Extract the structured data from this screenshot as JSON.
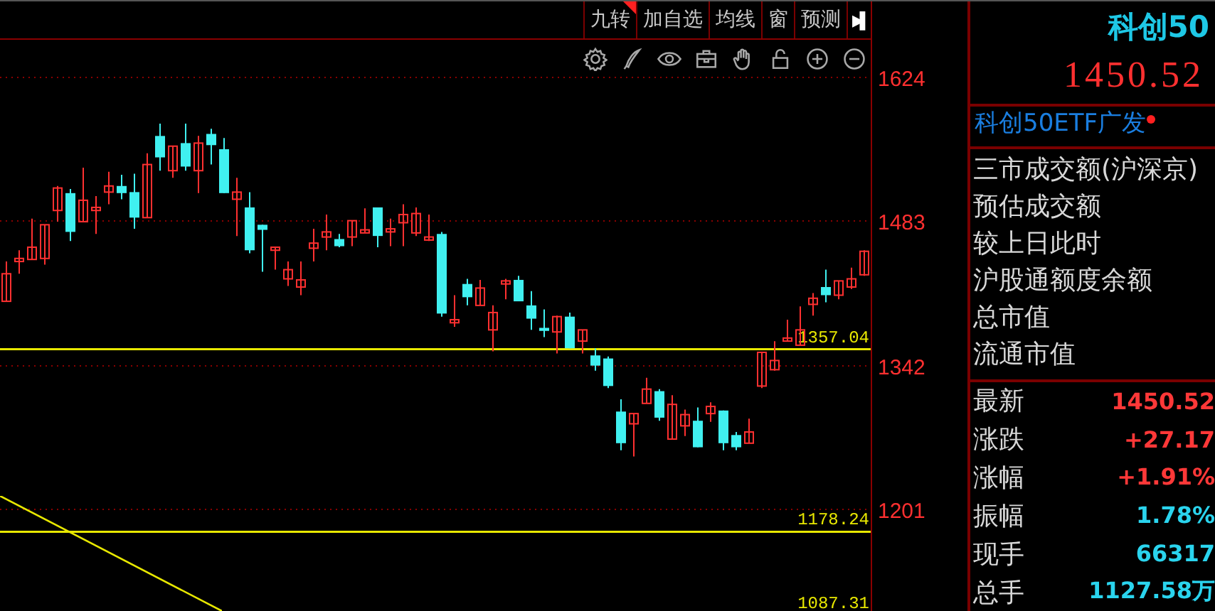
{
  "toolbar": {
    "buttons": [
      {
        "label": "九转",
        "flagged": true
      },
      {
        "label": "加自选",
        "flagged": false
      },
      {
        "label": "均线",
        "flagged": false
      },
      {
        "label": "窗",
        "flagged": false
      },
      {
        "label": "预测",
        "flagged": false
      }
    ],
    "end_button": "▶▌"
  },
  "chart": {
    "chart_data": {
      "type": "candlestick",
      "ylim": [
        1100.6,
        1697.8
      ],
      "yticks": [
        {
          "value": 1624,
          "label": "1624"
        },
        {
          "value": 1483,
          "label": "1483"
        },
        {
          "value": 1342,
          "label": "1342"
        },
        {
          "value": 1201,
          "label": "1201"
        }
      ],
      "categories": [
        null,
        null,
        null,
        null,
        null,
        null,
        null,
        null,
        null,
        null,
        null,
        null,
        null,
        null,
        null,
        null,
        null,
        null,
        null,
        null,
        null,
        null,
        null,
        null,
        null,
        null,
        null,
        null,
        null,
        null,
        null,
        null,
        null,
        null,
        null,
        null,
        null,
        null,
        null,
        null,
        null,
        null,
        null,
        null,
        null,
        null,
        null,
        null,
        null,
        null,
        null,
        null,
        null,
        null,
        null,
        null,
        null,
        null,
        null,
        null,
        null,
        null,
        null,
        null,
        null,
        null,
        null,
        null
      ],
      "ohlc": [
        [
          1404,
          1443,
          1404,
          1431
        ],
        [
          1443,
          1454,
          1431,
          1446
        ],
        [
          1445,
          1485,
          1445,
          1457
        ],
        [
          1446,
          1479,
          1440,
          1479
        ],
        [
          1493,
          1517,
          1482,
          1515
        ],
        [
          1510,
          1514,
          1463,
          1472
        ],
        [
          1482,
          1535,
          1482,
          1503
        ],
        [
          1493,
          1507,
          1470,
          1496
        ],
        [
          1511,
          1531,
          1499,
          1517
        ],
        [
          1517,
          1528,
          1504,
          1510
        ],
        [
          1511,
          1529,
          1475,
          1486
        ],
        [
          1486,
          1549,
          1486,
          1538
        ],
        [
          1566,
          1578,
          1532,
          1545
        ],
        [
          1532,
          1556,
          1525,
          1556
        ],
        [
          1559,
          1578,
          1532,
          1536
        ],
        [
          1532,
          1566,
          1510,
          1559
        ],
        [
          1568,
          1573,
          1538,
          1557
        ],
        [
          1553,
          1564,
          1510,
          1510
        ],
        [
          1504,
          1525,
          1468,
          1511
        ],
        [
          1496,
          1511,
          1451,
          1454
        ],
        [
          1479,
          1479,
          1433,
          1474
        ],
        [
          1454,
          1457,
          1435,
          1457
        ],
        [
          1426,
          1443,
          1419,
          1435
        ],
        [
          1418,
          1443,
          1410,
          1425
        ],
        [
          1456,
          1475,
          1443,
          1461
        ],
        [
          1467,
          1489,
          1454,
          1472
        ],
        [
          1465,
          1470,
          1457,
          1458
        ],
        [
          1467,
          1483,
          1458,
          1483
        ],
        [
          1471,
          1495,
          1471,
          1474
        ],
        [
          1496,
          1496,
          1457,
          1468
        ],
        [
          1472,
          1485,
          1458,
          1475
        ],
        [
          1481,
          1499,
          1458,
          1489
        ],
        [
          1471,
          1496,
          1468,
          1490
        ],
        [
          1464,
          1489,
          1463,
          1467
        ],
        [
          1470,
          1472,
          1389,
          1392
        ],
        [
          1383,
          1410,
          1379,
          1386
        ],
        [
          1421,
          1426,
          1400,
          1408
        ],
        [
          1400,
          1425,
          1400,
          1417
        ],
        [
          1376,
          1400,
          1355,
          1393
        ],
        [
          1421,
          1426,
          1406,
          1424
        ],
        [
          1425,
          1429,
          1404,
          1404
        ],
        [
          1400,
          1414,
          1376,
          1387
        ],
        [
          1378,
          1396,
          1369,
          1375
        ],
        [
          1374,
          1390,
          1353,
          1389
        ],
        [
          1389,
          1393,
          1358,
          1358
        ],
        [
          1365,
          1376,
          1353,
          1376
        ],
        [
          1351,
          1358,
          1336,
          1341
        ],
        [
          1348,
          1350,
          1319,
          1321
        ],
        [
          1296,
          1308,
          1258,
          1265
        ],
        [
          1284,
          1294,
          1252,
          1294
        ],
        [
          1304,
          1329,
          1304,
          1318
        ],
        [
          1316,
          1318,
          1287,
          1290
        ],
        [
          1269,
          1312,
          1269,
          1303
        ],
        [
          1282,
          1298,
          1272,
          1293
        ],
        [
          1287,
          1300,
          1261,
          1261
        ],
        [
          1294,
          1305,
          1286,
          1301
        ],
        [
          1297,
          1297,
          1258,
          1265
        ],
        [
          1273,
          1276,
          1258,
          1261
        ],
        [
          1265,
          1289,
          1265,
          1276
        ],
        [
          1321,
          1354,
          1319,
          1354
        ],
        [
          1337,
          1365,
          1336,
          1346
        ],
        [
          1365,
          1386,
          1365,
          1368
        ],
        [
          1361,
          1399,
          1361,
          1376
        ],
        [
          1401,
          1412,
          1390,
          1407
        ],
        [
          1418,
          1435,
          1403,
          1410
        ],
        [
          1410,
          1424,
          1406,
          1424
        ],
        [
          1418,
          1437,
          1416,
          1426
        ],
        [
          1430,
          1454,
          1429,
          1453
        ]
      ],
      "ref_lines": [
        {
          "axis": "y",
          "value": 1357.04,
          "label": "1357.04"
        },
        {
          "axis": "y",
          "value": 1178.24,
          "label": "1178.24"
        }
      ],
      "grid": true
    },
    "offscale_label": "1087.31"
  },
  "quote": {
    "name": "科创50",
    "price": "1450.52",
    "fund": "科创50ETF广发",
    "fund_alert": true
  },
  "info_labels": [
    "三市成交额(沪深京)",
    "预估成交额",
    "较上日此时",
    "沪股通额度余额",
    "总市值",
    "流通市值"
  ],
  "stats": [
    {
      "label": "最新",
      "value": "1450.52",
      "color": "#ff3838"
    },
    {
      "label": "涨跌",
      "value": "+27.17",
      "color": "#ff3838"
    },
    {
      "label": "涨幅",
      "value": "+1.91%",
      "color": "#ff3838"
    },
    {
      "label": "振幅",
      "value": "1.78%",
      "color": "#2ad4ee"
    },
    {
      "label": "现手",
      "value": "66317",
      "color": "#2ad4ee"
    },
    {
      "label": "总手",
      "value": "1127.58万",
      "color": "#2ad4ee"
    }
  ]
}
